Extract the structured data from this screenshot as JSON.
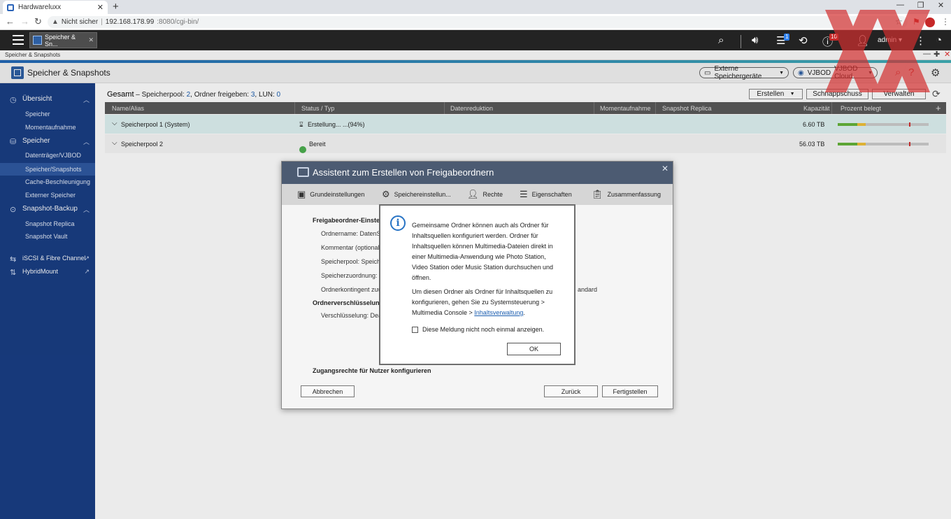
{
  "browser": {
    "tab_title": "Hardwareluxx",
    "url_warning": "Nicht sicher",
    "url_host": "192.168.178.99",
    "url_rest": ":8080/cgi-bin/"
  },
  "qts": {
    "app_tab": "Speicher & Sn...",
    "notification_count": "1",
    "notification_count2": "10",
    "user": "admin"
  },
  "app": {
    "window_label": "Speicher & Snapshots",
    "title": "Speicher & Snapshots",
    "external_button": "Externe Speichergeräte",
    "vjbod_button": "VJBOD",
    "vjbod_cloud": "VJBOD Cloud"
  },
  "sidebar": {
    "overview": "Übersicht",
    "overview_items": [
      "Speicher",
      "Momentaufnahme"
    ],
    "storage": "Speicher",
    "storage_items": [
      "Datenträger/VJBOD",
      "Speicher/Snapshots",
      "Cache-Beschleunigung",
      "Externer Speicher"
    ],
    "snapshot_backup": "Snapshot-Backup",
    "snapshot_items": [
      "Snapshot Replica",
      "Snapshot Vault"
    ],
    "iscsi": "iSCSI & Fibre Channel",
    "hybridmount": "HybridMount"
  },
  "main": {
    "summary_title": "Gesamt",
    "summary_dash": "–",
    "pool_label": "Speicherpool:",
    "pool_count": "2",
    "shared_label": ", Ordner freigeben:",
    "shared_count": "3",
    "lun_label": ", LUN:",
    "lun_count": "0",
    "create_button": "Erstellen",
    "snapshot_button": "Schnappschuss",
    "manage_button": "Verwalten",
    "columns": [
      "Name/Alias",
      "Status / Typ",
      "Datenreduktion",
      "Momentaufnahme",
      "Snapshot Replica",
      "Kapazität",
      "Prozent belegt"
    ],
    "rows": [
      {
        "name": "Speicherpool 1 (System)",
        "status": "Erstellung... ...(94%)",
        "capacity": "6.60 TB",
        "used_pct": 0.3
      },
      {
        "name": "Speicherpool 2",
        "status": "Bereit",
        "capacity": "56.03 TB",
        "used_pct": 0.3
      }
    ]
  },
  "wizard": {
    "title": "Assistent zum Erstellen von Freigabeordnern",
    "steps": [
      "Grundeinstellungen",
      "Speichereinstellun...",
      "Rechte",
      "Eigenschaften",
      "Zusammenfassung"
    ],
    "section1": "Freigabeordner-Einstell",
    "f_name": "Ordnername: DatenSSD",
    "f_comment": "Kommentar (optional):",
    "f_pool": "Speicherpool: Speicher",
    "f_alloc": "Speicherzuordnung: Th",
    "f_quota": "Ordnerkontingent zuwe",
    "f_quota_tail": "andard",
    "section2": "Ordnerverschlüsselung",
    "f_enc": "Verschlüsselung: Deakt",
    "access": "Zugangsrechte für Nutzer konfigurieren",
    "cancel": "Abbrechen",
    "back": "Zurück",
    "finish": "Fertigstellen"
  },
  "dialog": {
    "p1": "Gemeinsame Ordner können auch als Ordner für Inhaltsquellen konfiguriert werden. Ordner für Inhaltsquellen können Multimedia-Dateien direkt in einer Multimedia-Anwendung wie Photo Station, Video Station oder Music Station durchsuchen und öffnen.",
    "p2_pre": "Um diesen Ordner als Ordner für Inhaltsquellen zu konfigurieren, gehen Sie zu Systemsteuerung > Multimedia Console > ",
    "p2_link": "Inhaltsverwaltung",
    "p2_post": ".",
    "checkbox": "Diese Meldung nicht noch einmal anzeigen.",
    "ok": "OK"
  }
}
